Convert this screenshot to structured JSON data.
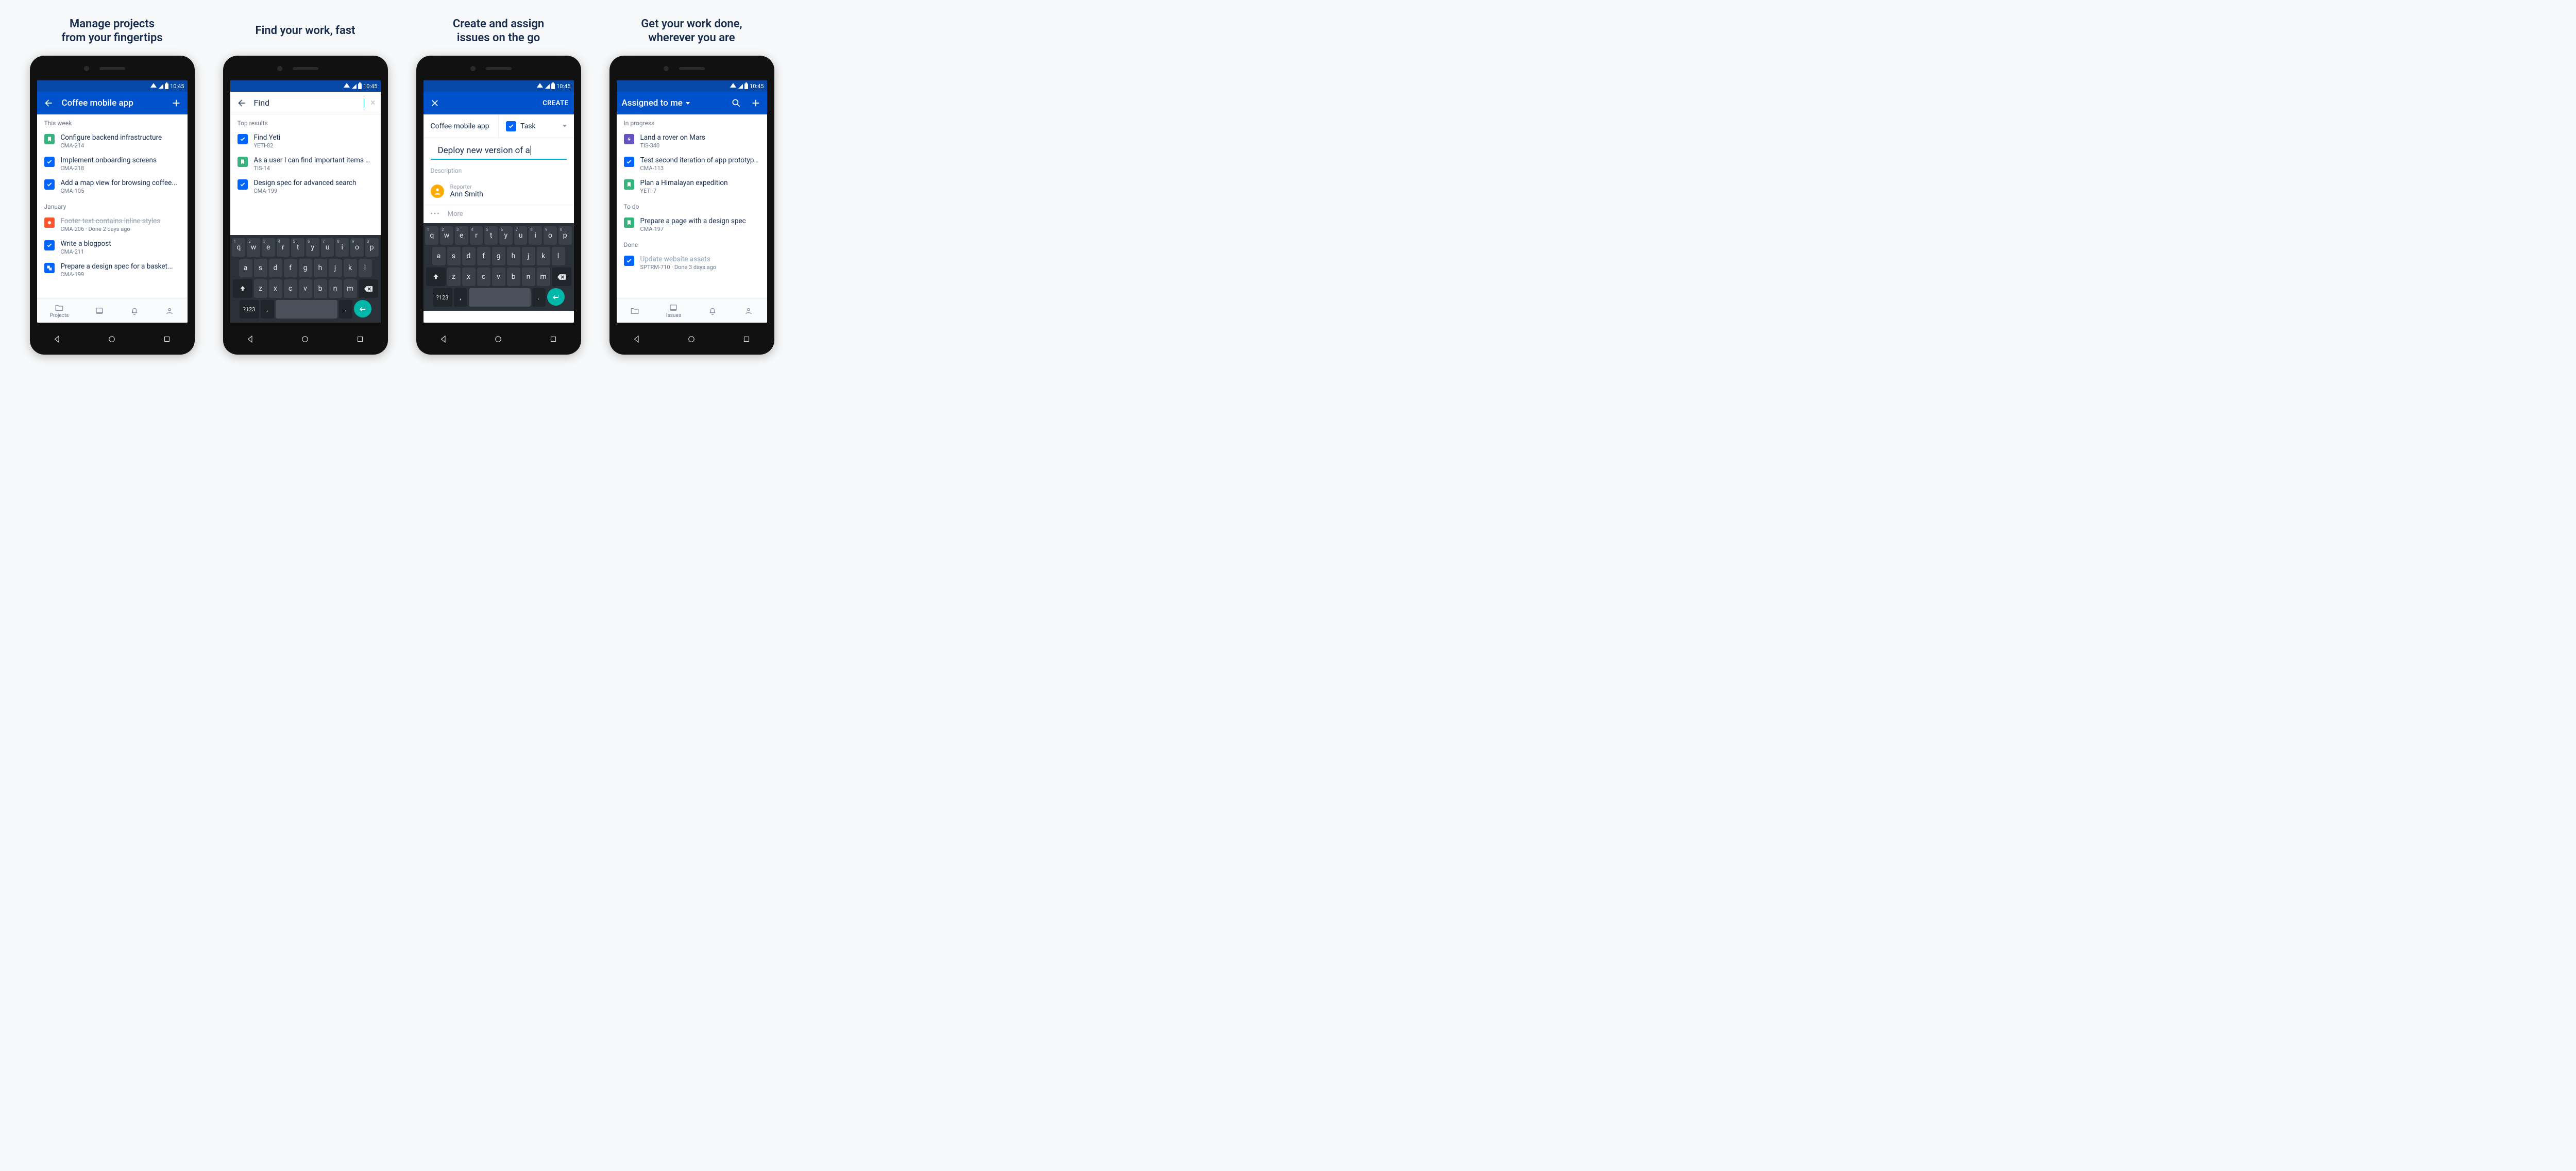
{
  "status_time": "10:45",
  "captions": [
    "Manage projects\nfrom your fingertips",
    "Find your work, fast",
    "Create and assign\nissues on the go",
    "Get your work done,\nwherever you are"
  ],
  "screen1": {
    "title": "Coffee mobile app",
    "sections": [
      {
        "header": "This week",
        "items": [
          {
            "type": "story",
            "title": "Configure backend infrastructure",
            "meta": "CMA-214"
          },
          {
            "type": "task",
            "title": "Implement onboarding screens",
            "meta": "CMA-218"
          },
          {
            "type": "task",
            "title": "Add a map view for browsing coffee...",
            "meta": "CMA-105"
          }
        ]
      },
      {
        "header": "January",
        "items": [
          {
            "type": "bug",
            "title": "Footer text contains inline styles",
            "meta": "CMA-206 · Done 2 days ago",
            "done": true
          },
          {
            "type": "task",
            "title": "Write a blogpost",
            "meta": "CMA-211"
          },
          {
            "type": "sub",
            "title": "Prepare a design spec for a basket...",
            "meta": "CMA-199"
          }
        ]
      }
    ],
    "bottom": {
      "projects": "Projects"
    }
  },
  "screen2": {
    "query": "Find",
    "header": "Top results",
    "results": [
      {
        "type": "task",
        "title": "Find Yeti",
        "meta": "YETI-82"
      },
      {
        "type": "story",
        "title": "As a user I can find important items o...",
        "meta": "TIS-14"
      },
      {
        "type": "task",
        "title": "Design spec for advanced search",
        "meta": "CMA-199"
      }
    ]
  },
  "screen3": {
    "action": "CREATE",
    "project": "Coffee mobile app",
    "issue_type": "Task",
    "summary": "Deploy new version of a",
    "description_label": "Description",
    "reporter_label": "Reporter",
    "reporter_name": "Ann Smith",
    "more": "More"
  },
  "screen4": {
    "title": "Assigned to me",
    "sections": [
      {
        "header": "In progress",
        "items": [
          {
            "type": "epic",
            "title": "Land a rover on Mars",
            "meta": "TIS-340"
          },
          {
            "type": "task",
            "title": "Test second iteration of app prototypes",
            "meta": "CMA-113"
          },
          {
            "type": "story",
            "title": "Plan a Himalayan expedition",
            "meta": "YETI-7"
          }
        ]
      },
      {
        "header": "To do",
        "items": [
          {
            "type": "story",
            "title": "Prepare a page with a design spec",
            "meta": "CMA-197"
          }
        ]
      },
      {
        "header": "Done",
        "items": [
          {
            "type": "task",
            "title": "Update website assets",
            "meta": "SPTRM-710 · Done 3 days ago",
            "done": true
          }
        ]
      }
    ],
    "bottom": {
      "issues": "Issues"
    }
  },
  "keyboard": {
    "row1": [
      "q",
      "w",
      "e",
      "r",
      "t",
      "y",
      "u",
      "i",
      "o",
      "p"
    ],
    "nums": [
      "1",
      "2",
      "3",
      "4",
      "5",
      "6",
      "7",
      "8",
      "9",
      "0"
    ],
    "row2": [
      "a",
      "s",
      "d",
      "f",
      "g",
      "h",
      "j",
      "k",
      "l"
    ],
    "row3": [
      "z",
      "x",
      "c",
      "v",
      "b",
      "n",
      "m"
    ],
    "sym": "?123",
    "comma": ",",
    "period": "."
  }
}
